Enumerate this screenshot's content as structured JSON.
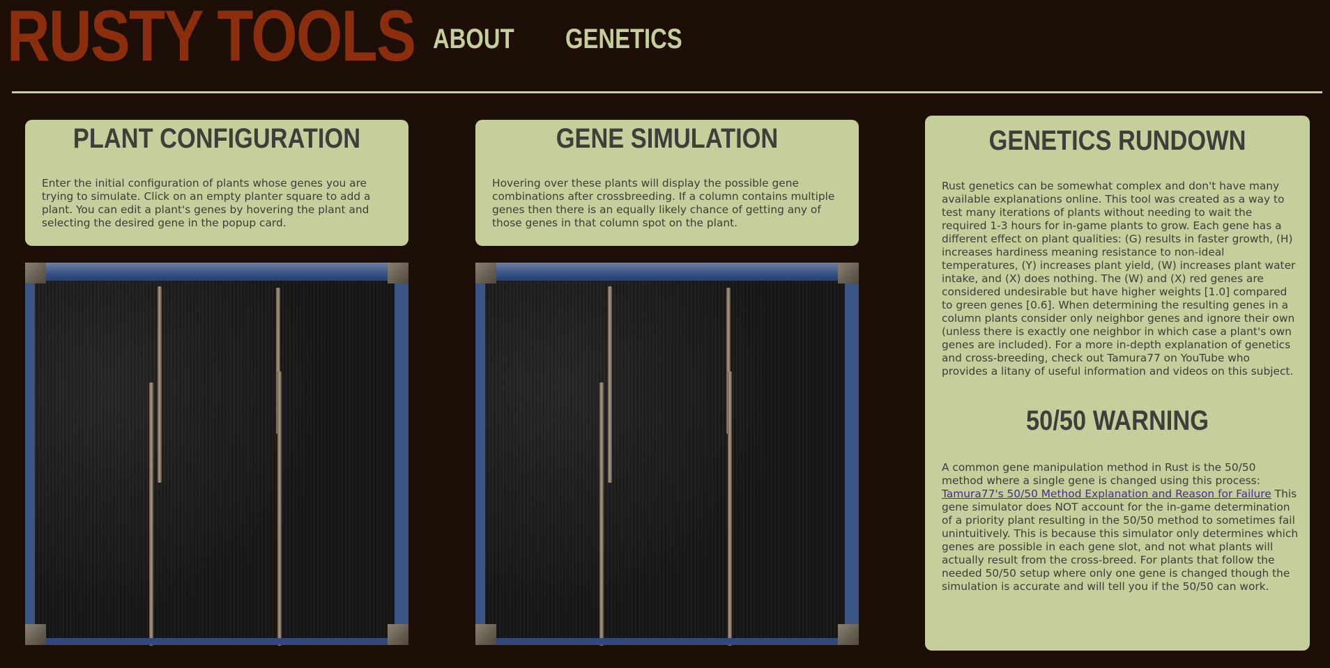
{
  "header": {
    "logo": "RUSTY TOOLS",
    "nav": [
      {
        "label": "ABOUT"
      },
      {
        "label": "GENETICS"
      }
    ]
  },
  "plant_configuration": {
    "title": "PLANT CONFIGURATION",
    "body": "Enter the initial configuration of plants whose genes you are trying to simulate. Click on an empty planter square to add a plant. You can edit a plant's genes by hovering the plant and selecting the desired gene in the popup card."
  },
  "gene_simulation": {
    "title": "GENE SIMULATION",
    "body": "Hovering over these plants will display the possible gene combinations after crossbreeding. If a column contains multiple genes then there is an equally likely chance of getting any of those genes in that column spot on the plant."
  },
  "genetics_rundown": {
    "title": "GENETICS RUNDOWN",
    "body": "Rust genetics can be somewhat complex and don't have many available explanations online. This tool was created as a way to test many iterations of plants without needing to wait the required 1-3 hours for in-game plants to grow. Each gene has a different effect on plant qualities: (G) results in faster growth, (H) increases hardiness meaning resistance to non-ideal temperatures, (Y) increases plant yield, (W) increases plant water intake, and (X) does nothing. The (W) and (X) red genes are considered undesirable but have higher weights [1.0] compared to green genes [0.6]. When determining the resulting genes in a column plants consider only neighbor genes and ignore their own (unless there is exactly one neighbor in which case a plant's own genes are included). For a more in-depth explanation of genetics and cross-breeding, check out Tamura77 on YouTube who provides a litany of useful information and videos on this subject."
  },
  "warning": {
    "title": "50/50 WARNING",
    "intro": "A common gene manipulation method in Rust is the 50/50 method where a single gene is changed using this process:",
    "link_text": "Tamura77's 50/50 Method Explanation and Reason for Failure",
    "body": "This gene simulator does NOT account for the in-game determination of a priority plant resulting in the 50/50 method to sometimes fail unintuitively. This is because this simulator only determines which genes are possible in each gene slot, and not what plants will actually result from the cross-breed. For plants that follow the needed 50/50 setup where only one gene is changed though the simulation is accurate and will tell you if the 50/50 can work."
  },
  "colors": {
    "background": "#1d0e08",
    "logo": "#8b2e0e",
    "nav_and_cards": "#c5cf9c",
    "card_text": "#3d3c38",
    "link": "#4b2a8f",
    "planter_frame": "#3a5485"
  }
}
